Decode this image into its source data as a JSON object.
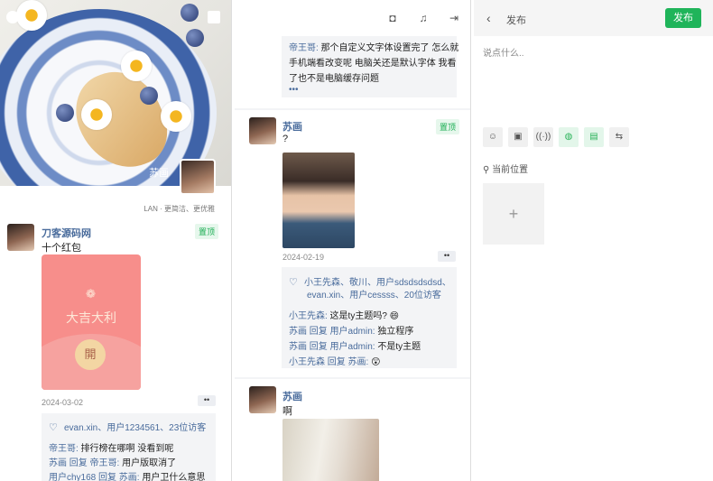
{
  "left": {
    "cover_name": "苏画",
    "tagline": "LAN · 更简洁、更优雅",
    "post": {
      "user": "刀客源码网",
      "badge": "置顶",
      "text": "十个红包",
      "red_packet_title": "大吉大利",
      "red_packet_open": "開",
      "date": "2024-03-02",
      "more": "••",
      "likes": "evan.xin、用户1234561、23位访客",
      "comments": [
        {
          "name": "帝王哥:",
          "reply": "",
          "text": " 排行榜在哪啊 没看到呢"
        },
        {
          "name": "苏画",
          "reply": " 回复 帝王哥:",
          "text": " 用户版取消了"
        },
        {
          "name": "用户chy168",
          "reply": " 回复 苏画:",
          "text": " 用户卫什么意思"
        }
      ]
    }
  },
  "middle": {
    "top_comment": {
      "name": "帝王哥:",
      "lines": [
        "那个自定义文字体设置完了 怎么就",
        "手机端看改变呢 电脑关还是默认字体 我看",
        "了也不是电脑缓存问题"
      ],
      "more": "•••"
    },
    "post1": {
      "user": "苏画",
      "badge": "置顶",
      "text": "?",
      "date": "2024-02-19",
      "more": "••",
      "likes_line1": "小王先森、敬川、用户sdsdsdsdsd、",
      "likes_line2": "evan.xin、用户cessss、20位访客",
      "comments": [
        {
          "name": "小王先森:",
          "reply": "",
          "text": " 这是ty主题吗? 😄"
        },
        {
          "name": "苏画",
          "reply": " 回复 用户admin:",
          "text": " 独立程序"
        },
        {
          "name": "苏画",
          "reply": " 回复 用户admin:",
          "text": " 不是ty主题"
        },
        {
          "name": "小王先森",
          "reply": " 回复 苏画:",
          "text": " 😲"
        }
      ]
    },
    "post2": {
      "user": "苏画",
      "text": "啊"
    }
  },
  "right": {
    "title": "发布",
    "publish": "发布",
    "placeholder": "说点什么..",
    "location": "当前位置",
    "add": "+"
  }
}
